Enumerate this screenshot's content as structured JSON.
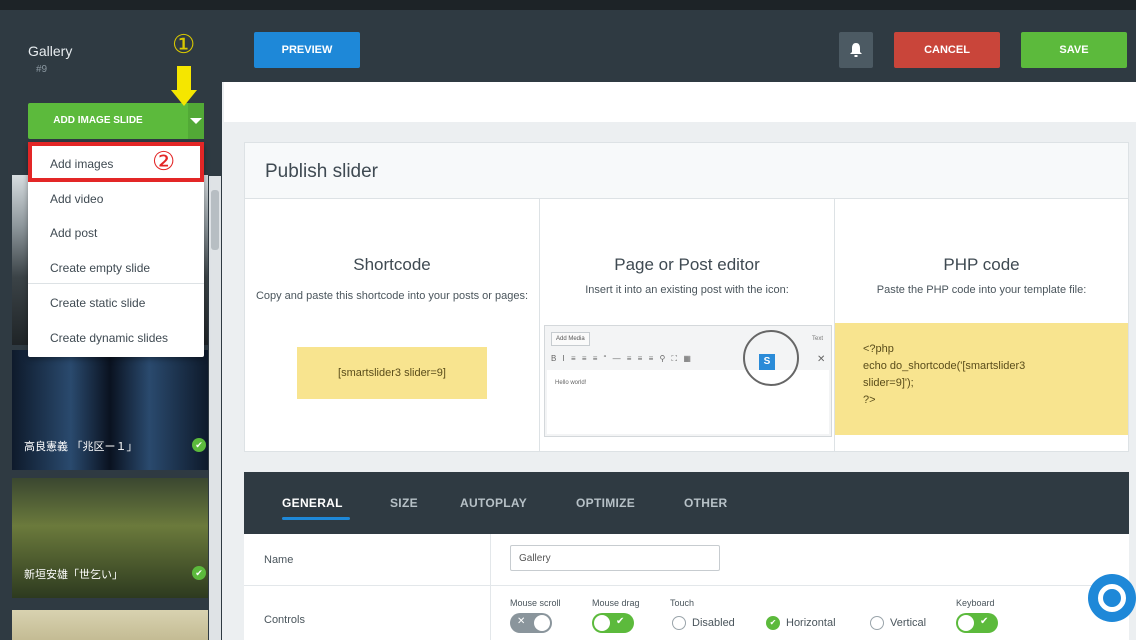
{
  "sidebar": {
    "title": "Gallery",
    "id": "#9",
    "add_button": "ADD IMAGE SLIDE",
    "dropdown": [
      "Add images",
      "Add video",
      "Add post",
      "Create empty slide",
      "Create static slide",
      "Create dynamic slides"
    ],
    "slides": [
      {
        "label": ""
      },
      {
        "label": "高良憲義 「兆区ー１」"
      },
      {
        "label": "新垣安雄「世乞い」"
      },
      {
        "label": ""
      }
    ],
    "markers": {
      "one": "①",
      "two": "②"
    }
  },
  "topbar": {
    "preview": "PREVIEW",
    "cancel": "CANCEL",
    "save": "SAVE"
  },
  "publish": {
    "title": "Publish slider",
    "shortcode": {
      "title": "Shortcode",
      "desc": "Copy and paste this shortcode into your posts or pages:",
      "code": "[smartslider3 slider=9]"
    },
    "editor": {
      "title": "Page or Post editor",
      "desc": "Insert it into an existing post with the icon:",
      "add_media": "Add Media",
      "text_tab": "Text",
      "toolbar": "B I ≡ ≡ ≡ “ — ≡ ≡ ≡ ⚲ ⛶ ▦",
      "hello": "Hello world!",
      "s_icon": "S",
      "x_icon": "✕"
    },
    "php": {
      "title": "PHP code",
      "desc": "Paste the PHP code into your template file:",
      "line1": "<?php",
      "line2": "echo do_shortcode('[smartslider3",
      "line3": "slider=9]');",
      "line4": "?>"
    }
  },
  "settings": {
    "tabs": [
      "GENERAL",
      "SIZE",
      "AUTOPLAY",
      "OPTIMIZE",
      "OTHER"
    ],
    "name_label": "Name",
    "name_value": "Gallery",
    "controls_label": "Controls",
    "mouse_scroll": "Mouse scroll",
    "mouse_drag": "Mouse drag",
    "touch": "Touch",
    "disabled": "Disabled",
    "horizontal": "Horizontal",
    "vertical": "Vertical",
    "keyboard": "Keyboard"
  },
  "colors": {
    "accent_blue": "#1e88d8",
    "green": "#5cba3c",
    "red": "#c9453a",
    "dark": "#2f3a42",
    "highlight_yellow": "#f8e48f"
  }
}
